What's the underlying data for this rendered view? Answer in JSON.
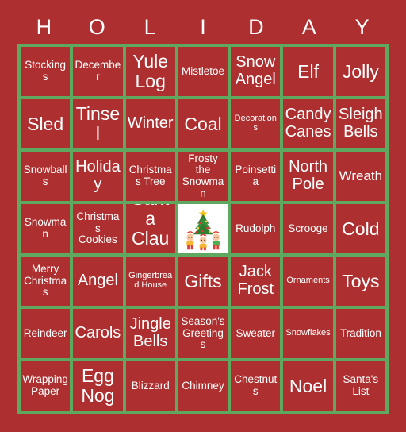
{
  "card": {
    "title": "HOLIDAY",
    "header_letters": [
      "H",
      "O",
      "L",
      "I",
      "D",
      "A",
      "Y"
    ],
    "colors": {
      "background": "#ad2f2f",
      "cell_background": "#ad2f2f",
      "grid_line": "#5fa860",
      "text": "#ffffff",
      "free_space_background": "#ffffff"
    },
    "grid_size": "7x7",
    "rows": [
      [
        {
          "text": "Stockings",
          "size": "sm"
        },
        {
          "text": "December",
          "size": "sm"
        },
        {
          "text": "Yule Log",
          "size": "xl"
        },
        {
          "text": "Mistletoe",
          "size": "sm"
        },
        {
          "text": "Snow Angel",
          "size": "lg"
        },
        {
          "text": "Elf",
          "size": "xl"
        },
        {
          "text": "Jolly",
          "size": "xl"
        }
      ],
      [
        {
          "text": "Sled",
          "size": "xl"
        },
        {
          "text": "Tinsel",
          "size": "xl"
        },
        {
          "text": "Winter",
          "size": "lg"
        },
        {
          "text": "Coal",
          "size": "xl"
        },
        {
          "text": "Decorations",
          "size": "xs"
        },
        {
          "text": "Candy Canes",
          "size": "lg"
        },
        {
          "text": "Sleigh Bells",
          "size": "lg"
        }
      ],
      [
        {
          "text": "Snowballs",
          "size": "sm"
        },
        {
          "text": "Holiday",
          "size": "lg"
        },
        {
          "text": "Christmas Tree",
          "size": "sm"
        },
        {
          "text": "Frosty the Snowman",
          "size": "sm"
        },
        {
          "text": "Poinsettia",
          "size": "sm"
        },
        {
          "text": "North Pole",
          "size": "lg"
        },
        {
          "text": "Wreath",
          "size": "md"
        }
      ],
      [
        {
          "text": "Snowman",
          "size": "sm"
        },
        {
          "text": "Christmas Cookies",
          "size": "sm"
        },
        {
          "text": "Santa Claus",
          "size": "xl"
        },
        {
          "text": "",
          "size": "md",
          "free_space": true,
          "icon": "christmas-tree-with-children"
        },
        {
          "text": "Rudolph",
          "size": "sm"
        },
        {
          "text": "Scrooge",
          "size": "sm"
        },
        {
          "text": "Cold",
          "size": "xl"
        }
      ],
      [
        {
          "text": "Merry Christmas",
          "size": "sm"
        },
        {
          "text": "Angel",
          "size": "lg"
        },
        {
          "text": "Gingerbread House",
          "size": "xs"
        },
        {
          "text": "Gifts",
          "size": "xl"
        },
        {
          "text": "Jack Frost",
          "size": "lg"
        },
        {
          "text": "Ornaments",
          "size": "xs"
        },
        {
          "text": "Toys",
          "size": "xl"
        }
      ],
      [
        {
          "text": "Reindeer",
          "size": "sm"
        },
        {
          "text": "Carols",
          "size": "lg"
        },
        {
          "text": "Jingle Bells",
          "size": "lg"
        },
        {
          "text": "Season's Greetings",
          "size": "sm"
        },
        {
          "text": "Sweater",
          "size": "sm"
        },
        {
          "text": "Snowflakes",
          "size": "xs"
        },
        {
          "text": "Tradition",
          "size": "sm"
        }
      ],
      [
        {
          "text": "Wrapping Paper",
          "size": "sm"
        },
        {
          "text": "Egg Nog",
          "size": "xl"
        },
        {
          "text": "Blizzard",
          "size": "sm"
        },
        {
          "text": "Chimney",
          "size": "sm"
        },
        {
          "text": "Chestnuts",
          "size": "sm"
        },
        {
          "text": "Noel",
          "size": "xl"
        },
        {
          "text": "Santa's List",
          "size": "sm"
        }
      ]
    ]
  }
}
